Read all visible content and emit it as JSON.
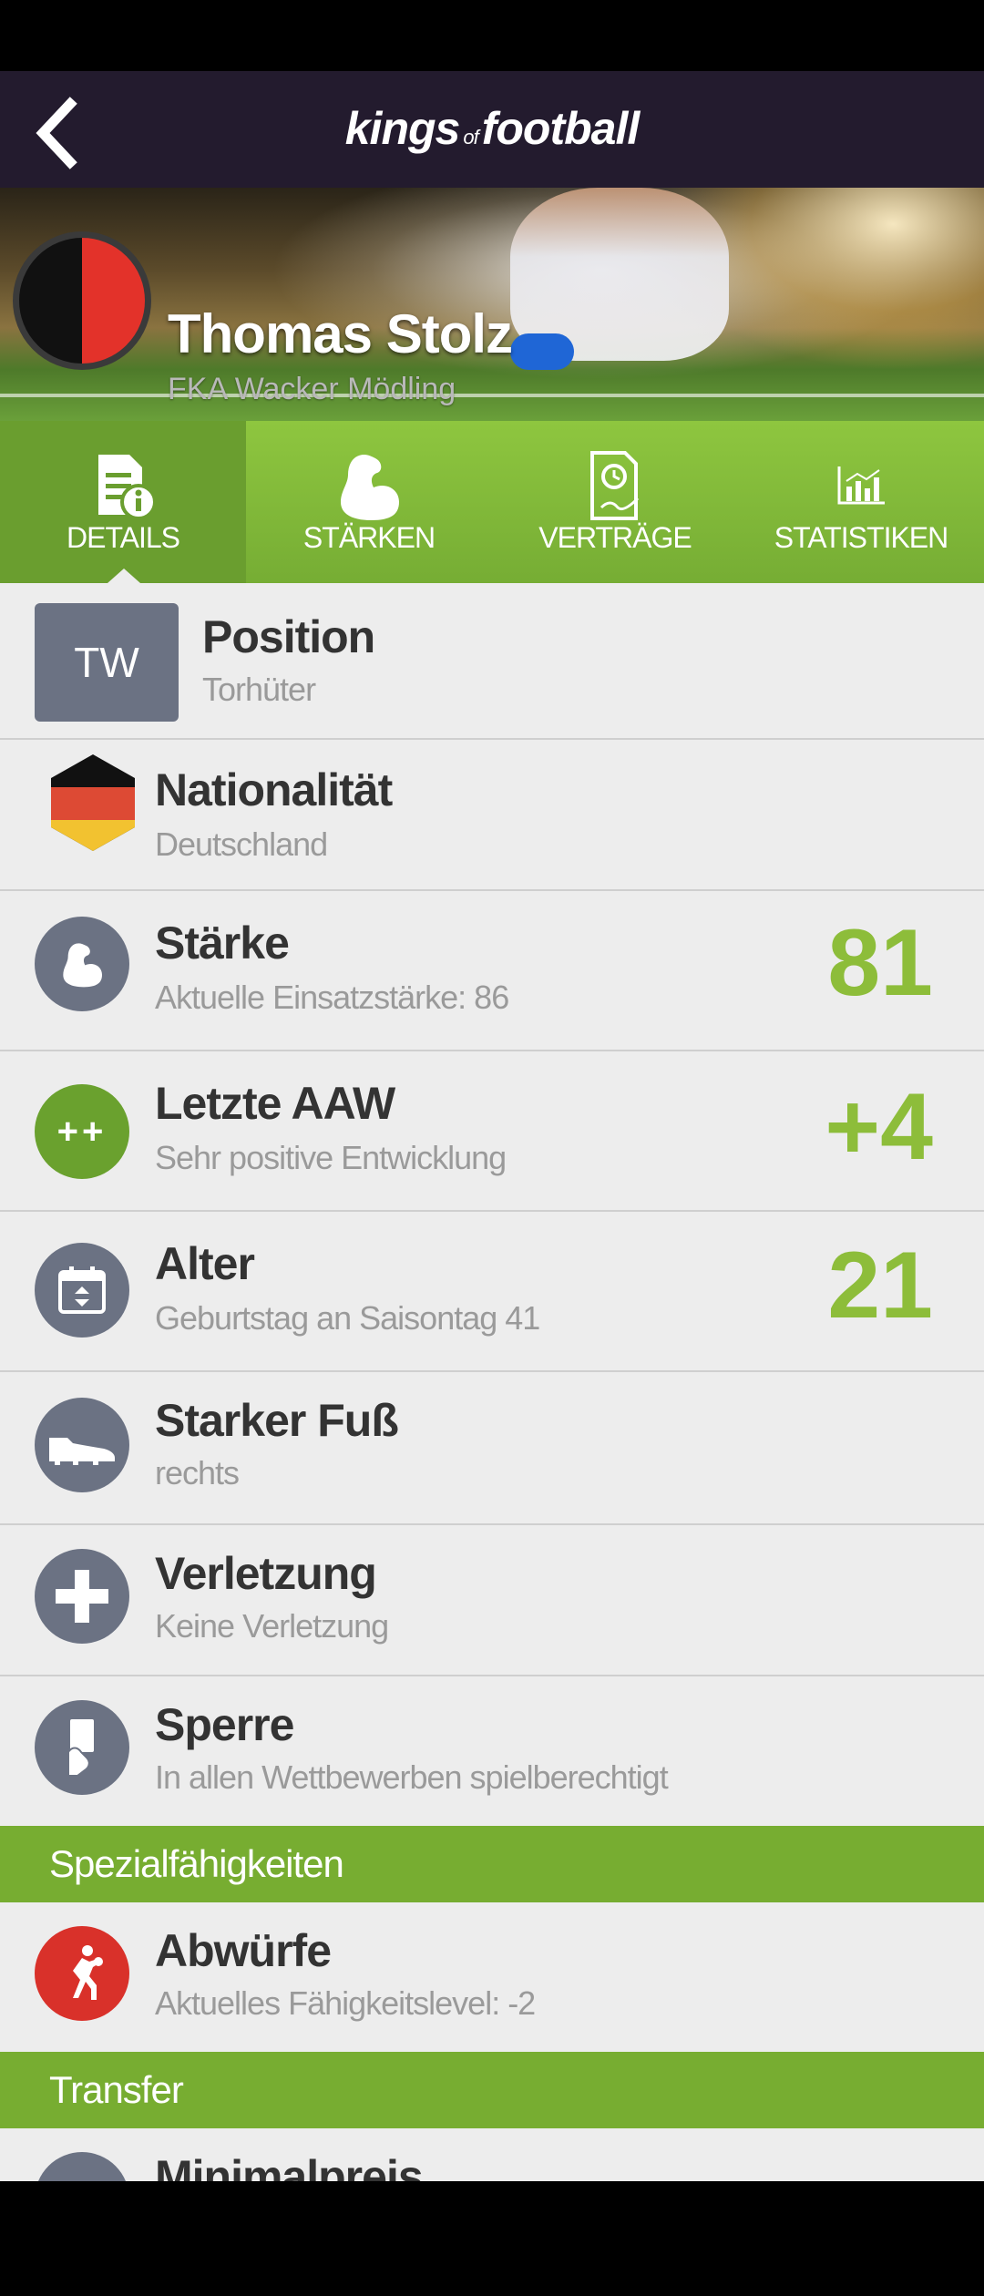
{
  "header": {
    "logo_left": "kings",
    "logo_of": "of",
    "logo_right": "football"
  },
  "hero": {
    "player_name": "Thomas Stolz",
    "club_name": "FKA Wacker Mödling"
  },
  "tabs": [
    {
      "label": "DETAILS"
    },
    {
      "label": "STÄRKEN"
    },
    {
      "label": "VERTRÄGE"
    },
    {
      "label": "STATISTIKEN"
    }
  ],
  "details": {
    "position": {
      "badge": "TW",
      "title": "Position",
      "value": "Torhüter"
    },
    "nationality": {
      "title": "Nationalität",
      "value": "Deutschland"
    },
    "strength": {
      "title": "Stärke",
      "value": "Aktuelle Einsatzstärke: 86",
      "number": "81"
    },
    "last_aaw": {
      "title": "Letzte AAW",
      "value": "Sehr positive Entwicklung",
      "number": "+4",
      "icon_text": "++"
    },
    "age": {
      "title": "Alter",
      "value": "Geburtstag an Saisontag 41",
      "number": "21"
    },
    "foot": {
      "title": "Starker Fuß",
      "value": "rechts"
    },
    "injury": {
      "title": "Verletzung",
      "value": "Keine Verletzung"
    },
    "suspension": {
      "title": "Sperre",
      "value": "In allen Wettbewerben spielberechtigt"
    }
  },
  "special": {
    "header": "Spezialfähigkeiten",
    "throws": {
      "title": "Abwürfe",
      "value": "Aktuelles Fähigkeitslevel: -2"
    }
  },
  "transfer": {
    "header": "Transfer",
    "min_price": {
      "title": "Minimalpreis"
    }
  },
  "colors": {
    "accent": "#8dbd3a",
    "header_bg": "#231b2e",
    "icon_gray": "#6b7283",
    "red": "#d9312a"
  }
}
